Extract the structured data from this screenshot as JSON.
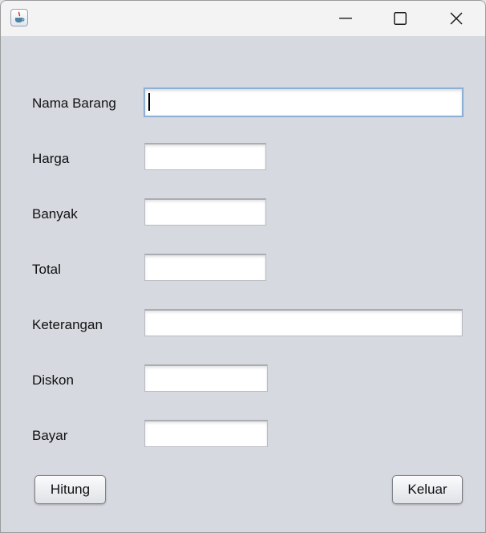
{
  "window": {
    "icon": "java-cup-icon",
    "controls": {
      "minimize": "minimize-icon",
      "maximize": "maximize-icon",
      "close": "close-icon"
    }
  },
  "form": {
    "nama_barang": {
      "label": "Nama Barang",
      "value": ""
    },
    "harga": {
      "label": "Harga",
      "value": ""
    },
    "banyak": {
      "label": "Banyak",
      "value": ""
    },
    "total": {
      "label": "Total",
      "value": ""
    },
    "keterangan": {
      "label": "Keterangan",
      "value": ""
    },
    "diskon": {
      "label": "Diskon",
      "value": ""
    },
    "bayar": {
      "label": "Bayar",
      "value": ""
    }
  },
  "buttons": {
    "hitung": "Hitung",
    "keluar": "Keluar"
  }
}
